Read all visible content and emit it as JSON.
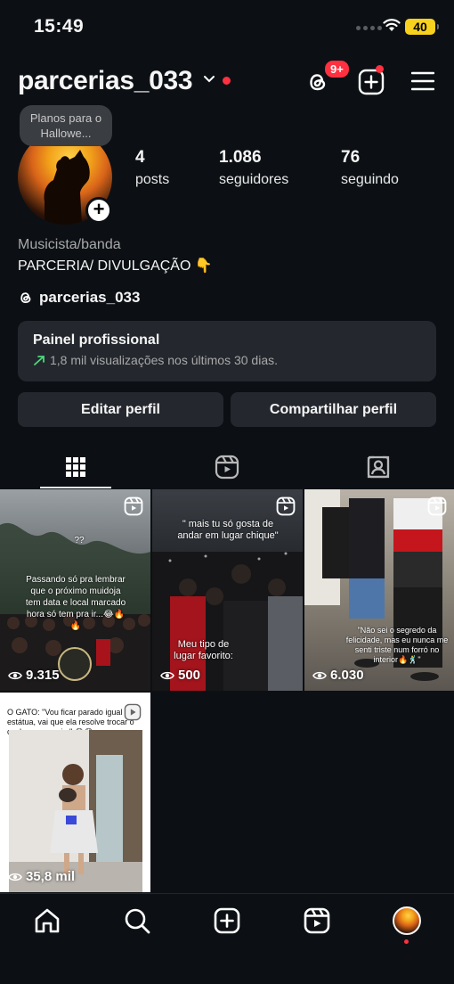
{
  "status_bar": {
    "time": "15:49",
    "battery": "40"
  },
  "header": {
    "username": "parcerias_033",
    "notification_badge": "9+"
  },
  "profile": {
    "note": "Planos para o Hallowe...",
    "stats": [
      {
        "value": "4",
        "label": "posts"
      },
      {
        "value": "1.086",
        "label": "seguidores"
      },
      {
        "value": "76",
        "label": "seguindo"
      }
    ],
    "category": "Musicista/banda",
    "bio": "PARCERIA/ DIVULGAÇÃO 👇",
    "threads_handle": "parcerias_033"
  },
  "professional_panel": {
    "title": "Painel profissional",
    "subtitle": "1,8 mil visualizações nos últimos 30 dias."
  },
  "buttons": {
    "edit": "Editar perfil",
    "share": "Compartilhar perfil"
  },
  "tabs": [
    "grid-icon",
    "reels-icon",
    "tagged-icon"
  ],
  "posts": [
    {
      "views": "9.315",
      "caption": "Passando só pra lembrar que o próximo muidoja tem data e local marcado hora só tem pra ir...😂🔥🔥",
      "top_text": "??"
    },
    {
      "views": "500",
      "caption_top": "\" mais tu só gosta de andar em lugar chique\"",
      "caption_bottom": "Meu tipo de lugar favorito:"
    },
    {
      "views": "6.030",
      "caption": "\"Não sei o segredo da felicidade, mas eu nunca me senti triste num forró no interior🔥🕺\""
    },
    {
      "views": "35,8 mil",
      "caption": "O GATO: \"Vou ficar parado igual estátua, vai que ela resolve trocar o cachorro por mim\" 😂😂"
    }
  ],
  "bottom_nav": [
    "home-icon",
    "search-icon",
    "create-icon",
    "reels-icon",
    "profile-avatar"
  ],
  "colors": {
    "background": "#0c1014",
    "panel": "#24282e",
    "accent_red": "#ff3040",
    "trend_green": "#4cd97b"
  }
}
